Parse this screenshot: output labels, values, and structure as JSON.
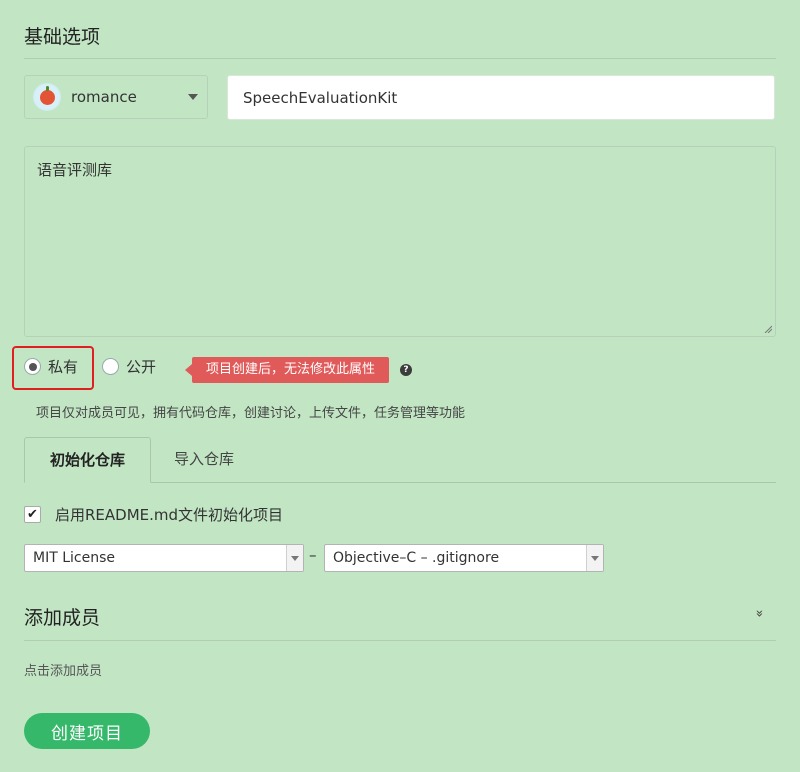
{
  "basic": {
    "title": "基础选项"
  },
  "owner": {
    "name": "romance",
    "avatar_icon": "apple-avatar-icon"
  },
  "repo": {
    "name": "SpeechEvaluationKit"
  },
  "description": {
    "value": "语音评测库"
  },
  "visibility": {
    "private_label": "私有",
    "public_label": "公开",
    "selected": "private",
    "tooltip": "项目创建后，无法修改此属性",
    "help_icon": "?",
    "hint": "项目仅对成员可见，拥有代码仓库，创建讨论，上传文件，任务管理等功能"
  },
  "tabs": [
    {
      "label": "初始化仓库",
      "active": true
    },
    {
      "label": "导入仓库",
      "active": false
    }
  ],
  "readme": {
    "label": "启用README.md文件初始化项目",
    "checked": true
  },
  "license": {
    "selected": "MIT License"
  },
  "separator": "–",
  "gitignore": {
    "selected": "Objective–C – .gitignore"
  },
  "members": {
    "title": "添加成员",
    "expand_icon": "»",
    "hint": "点击添加成员"
  },
  "actions": {
    "create_label": "创建项目"
  },
  "colors": {
    "background": "#c2e6c4",
    "primary_button": "#35b86a",
    "tooltip": "#e05a5a",
    "highlight": "#e02020"
  }
}
